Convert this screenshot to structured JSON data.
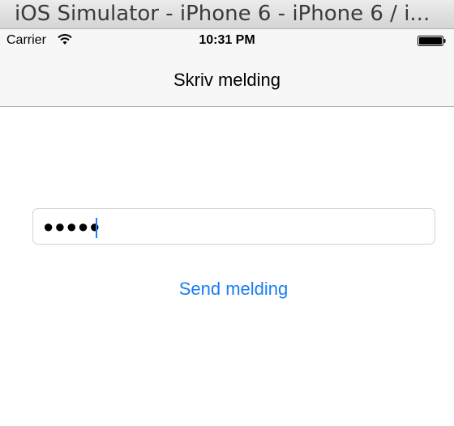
{
  "window": {
    "title": "iOS Simulator - iPhone 6 - iPhone 6 / i..."
  },
  "status_bar": {
    "carrier": "Carrier",
    "time": "10:31 PM"
  },
  "nav_bar": {
    "title": "Skriv melding"
  },
  "form": {
    "password_value": "●●●●●",
    "send_label": "Send melding"
  },
  "colors": {
    "accent": "#1a7df0",
    "bar_background": "#f7f7f7"
  }
}
